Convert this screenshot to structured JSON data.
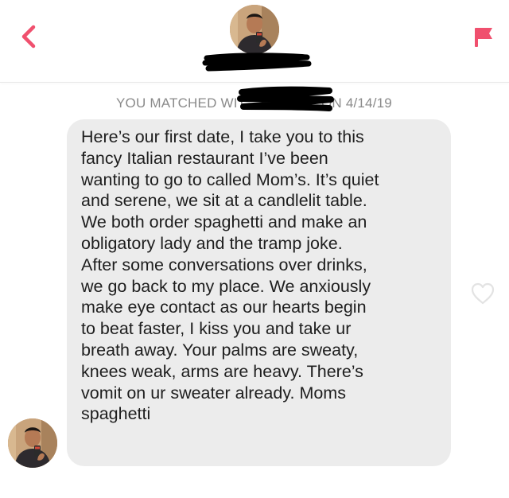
{
  "header": {
    "back_icon": "chevron-left-icon",
    "report_icon": "flag-icon",
    "accent_color": "#f0506e",
    "avatar_description": "profile photo"
  },
  "match": {
    "prefix": "YOU MATCHED WIT",
    "suffix": "ON 4/14/19",
    "text_color": "#8a8a8a"
  },
  "message": {
    "bubble_color": "#ececec",
    "lines": [
      "Here’s our first date, I take you to this",
      "fancy Italian restaurant I’ve been",
      "wanting to go to called Mom’s. It’s quiet",
      "and serene, we sit at a candlelit table.",
      "We both order spaghetti and make an",
      "obligatory lady and the tramp joke.",
      "After some conversations over drinks,",
      "we go back to my place. We anxiously",
      "make eye contact as our hearts begin",
      "to beat faster, I kiss you and take ur",
      "breath away. Your palms are sweaty,",
      "knees weak, arms are heavy. There’s",
      "vomit on ur sweater already. Moms",
      "spaghetti"
    ],
    "like_icon": "heart-outline-icon"
  }
}
